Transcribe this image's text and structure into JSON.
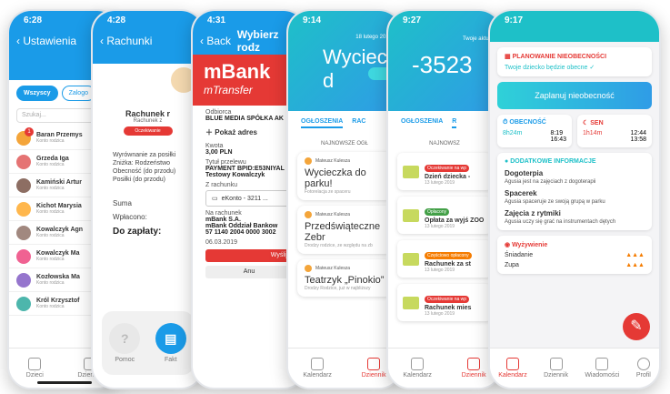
{
  "phone1": {
    "time": "6:28",
    "back_label": "Ustawienia",
    "chips": [
      "Wszyscy",
      "Zalogo"
    ],
    "search_placeholder": "Szukaj...",
    "children": [
      {
        "name": "Baran Przemys",
        "sub": "Konto rodzica"
      },
      {
        "name": "Grzeda Iga",
        "sub": "Konto rodzica"
      },
      {
        "name": "Kamiński Artur",
        "sub": "Konto rodzica"
      },
      {
        "name": "Kichot Marysia",
        "sub": "Konto rodzica"
      },
      {
        "name": "Kowalczyk Agn",
        "sub": "Konto rodzica"
      },
      {
        "name": "Kowalczyk Ma",
        "sub": "Konto rodzica"
      },
      {
        "name": "Kozłowska Ma",
        "sub": "Konto rodzica"
      },
      {
        "name": "Król Krzysztof",
        "sub": "Konto rodzica"
      }
    ],
    "badge": "1",
    "tabs": [
      "Dzieci",
      "Dziennik"
    ]
  },
  "phone2": {
    "time": "4:28",
    "back_label": "Rachunki",
    "title": "Rachunek r",
    "subtitle": "Rachunek z",
    "status": "Oczekiwanie",
    "rows": [
      "Wyrównanie za posiłki",
      "Zniżka: Rodzeństwo",
      "Obecność (do przodu)",
      "Posiłki (do przodu)"
    ],
    "sum_label": "Suma",
    "paid_label": "Wpłacono:",
    "due_label": "Do zapłaty:",
    "help_label": "Pomoc",
    "invoice_label": "Fakt"
  },
  "phone3": {
    "time": "4:31",
    "back_label": "Back",
    "title": "Wybierz rodz",
    "brand": "mBank",
    "brand_sub": "mTransfer",
    "recipient_label": "Odbiorca",
    "recipient": "BLUE MEDIA SPÓŁKA AK",
    "show_address": "Pokaż adres",
    "amount_label": "Kwota",
    "amount": "3,00 PLN",
    "transfer_title_label": "Tytuł przelewu",
    "transfer_title": "PAYMENT BPID:E53NIYAL Testowy Kowalczyk",
    "from_label": "Z rachunku",
    "from_account": "eKonto - 3211 ...",
    "to_label": "Na rachunek",
    "to_bank": "mBank S.A.",
    "to_branch": "mBank Oddział Bankow",
    "to_number": "57 1140 2004 0000 3002",
    "date": "06.03.2019",
    "send_label": "Wyślij",
    "cancel_label": "Anu"
  },
  "phone4": {
    "time": "9:14",
    "date": "18 lutego 2019",
    "headline": "Wycieczka d",
    "read_label": "Czytaj",
    "tabs": [
      "OGŁOSZENIA",
      "RAC"
    ],
    "section": "NAJNOWSZE OGŁ",
    "posts": [
      {
        "author": "Mateusz Kulesza",
        "title": "Wycieczka do parku!",
        "meta": "Fotorelacja ze spaceru"
      },
      {
        "author": "Mateusz Kulesza",
        "title": "Przedświąteczne Zebr",
        "meta": "Drodzy rodzice, ze względu na zb"
      },
      {
        "author": "Mateusz Kulesza",
        "title": "Teatrzyk „Pinokio”",
        "meta": "Drodzy Rodzice, już w najbliższy"
      }
    ],
    "bottom_tabs": [
      "Kalendarz",
      "Dziennik"
    ]
  },
  "phone5": {
    "time": "9:27",
    "balance_label": "Twoje aktua",
    "balance": "-3523",
    "tabs": [
      "OGŁOSZENIA",
      "R"
    ],
    "section": "NAJNOWSZ",
    "events": [
      {
        "tag": "Oczekiwanie na wp",
        "title": "Dzień dziecka -",
        "date": "13 lutego 2019",
        "color": "#e53935"
      },
      {
        "tag": "Opłacony",
        "title": "Opłata za wyjś ZOO",
        "date": "13 lutego 2019",
        "color": "#43a047"
      },
      {
        "tag": "Częściowo opłacony",
        "title": "Rachunek za st",
        "date": "13 lutego 2019",
        "color": "#f57c00"
      },
      {
        "tag": "Oczekiwanie na wp",
        "title": "Rachunek mies",
        "date": "13 lutego 2019",
        "color": "#e53935"
      }
    ],
    "bottom_tabs": [
      "Kalendarz",
      "Dziennik"
    ]
  },
  "phone6": {
    "time": "9:17",
    "plan_header": "PLANOWANIE NIEOBECNOŚCI",
    "plan_status": "Twoje dziecko będzie obecne ✓",
    "plan_button": "Zaplanuj nieobecność",
    "presence_label": "OBECNOŚĆ",
    "presence_total": "8h24m",
    "presence_in": "8:19",
    "presence_out": "16:43",
    "sleep_label": "SEN",
    "sleep_total": "1h14m",
    "sleep_in": "12:44",
    "sleep_out": "13:58",
    "info_header": "DODATKOWE INFORMACJE",
    "infos": [
      {
        "title": "Dogoterpia",
        "desc": "Agusia jest na zajęciach z dogoterapii"
      },
      {
        "title": "Spacerek",
        "desc": "Agusia spaceruje ze swoją grupą w parku"
      },
      {
        "title": "Zajęcia z rytmiki",
        "desc": "Agusia uczy się grać na instrumentach dętych"
      }
    ],
    "meal_header": "Wyżywienie",
    "meals": [
      "Śniadanie",
      "Zupa"
    ],
    "bottom_tabs": [
      "Kalendarz",
      "Dziennik",
      "Wiadomości",
      "Profil"
    ]
  },
  "colors": {
    "accent": "#1a9be8",
    "red": "#e53935",
    "teal": "#1ec0c8"
  }
}
